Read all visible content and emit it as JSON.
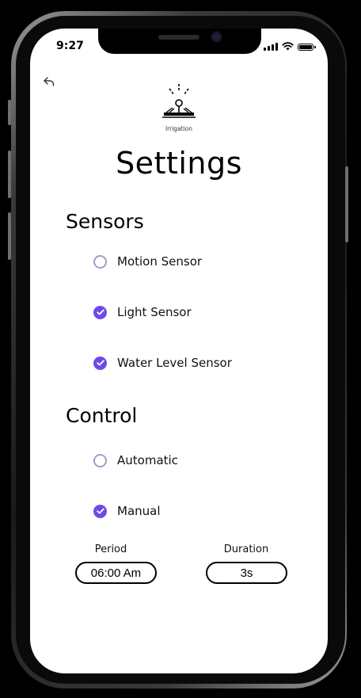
{
  "status_bar": {
    "time": "9:27"
  },
  "logo": {
    "label": "Irrigation"
  },
  "page": {
    "title": "Settings"
  },
  "sensors": {
    "title": "Sensors",
    "items": [
      {
        "label": "Motion Sensor",
        "checked": false
      },
      {
        "label": "Light Sensor",
        "checked": true
      },
      {
        "label": "Water Level Sensor",
        "checked": true
      }
    ]
  },
  "control": {
    "title": "Control",
    "items": [
      {
        "label": "Automatic",
        "checked": false
      },
      {
        "label": "Manual",
        "checked": true
      }
    ]
  },
  "period": {
    "label": "Period",
    "value": "06:00 Am"
  },
  "duration": {
    "label": "Duration",
    "value": "3s"
  },
  "colors": {
    "accent": "#6d4ae8",
    "radio_border": "#a49cc8"
  }
}
